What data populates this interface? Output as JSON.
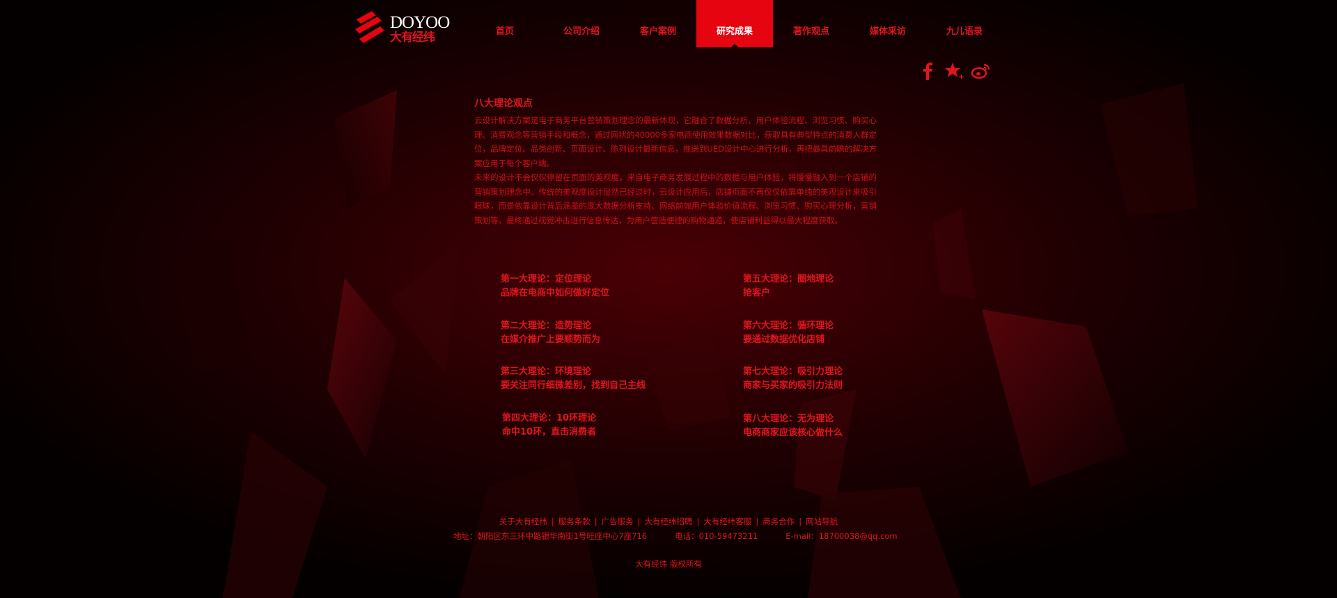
{
  "brand": {
    "name_en": "DOYOO",
    "name_cn": "大有经纬",
    "accent_color": "#e5040f"
  },
  "nav": {
    "items": [
      {
        "label": "首页",
        "active": false
      },
      {
        "label": "公司介绍",
        "active": false
      },
      {
        "label": "客户案例",
        "active": false
      },
      {
        "label": "研究成果",
        "active": true
      },
      {
        "label": "著作观点",
        "active": false
      },
      {
        "label": "媒体采访",
        "active": false
      },
      {
        "label": "九儿语录",
        "active": false
      }
    ]
  },
  "social": {
    "icons": [
      "facebook-icon",
      "star-icon",
      "weibo-icon"
    ]
  },
  "intro": {
    "title": "八大理论观点",
    "paragraph1": "云设计解决方案是电子商务平台营销策划理念的最新体现，它融合了数据分析、用户体验流程、浏览习惯、购买心理、消费观念等营销手段和概念，通过网状的40000多家电商使用效果数据对比，获取具有典型特点的消费人群定位，品牌定位、品类创新、页面设计、陈列设计最新信息，推送到UED设计中心进行分析，再把最具前瞻的解决方案应用于每个客户端。",
    "paragraph2": "未来的设计不会仅仅停留在页面的美观度，来自电子商务发展过程中的数据与用户体验，将慢慢融入到一个店铺的营销策划理念中。传统的美观度设计显然已经过时，云设计应用后，店铺页面不再仅仅依靠单纯的美观设计来吸引眼球，而是依靠设计背后涵盖的庞大数据分析支持、网络前端用户体验价值流程、浏览习惯、购买心理分析，营销策划等，最终通过视觉冲击进行信息传达，为用户营造便捷的购物通道，使店铺利益得以最大程度获取。"
  },
  "theories": [
    {
      "title": "第一大理论：定位理论",
      "desc": "品牌在电商中如何做好定位"
    },
    {
      "title": "第二大理论：造势理论",
      "desc": "在媒介推广上要顺势而为"
    },
    {
      "title": "第三大理论：环境理论",
      "desc": "要关注同行细微差别，找到自己主线"
    },
    {
      "title": "第四大理论：10环理论",
      "desc": "命中10环，直击消费者"
    },
    {
      "title": "第五大理论：圈地理论",
      "desc": "抢客户"
    },
    {
      "title": "第六大理论：循环理论",
      "desc": "要通过数据优化店铺"
    },
    {
      "title": "第七大理论：吸引力理论",
      "desc": "商家与买家的吸引力法则"
    },
    {
      "title": "第八大理论：无为理论",
      "desc": "电商商家应该核心做什么"
    }
  ],
  "footer": {
    "links": [
      "关于大有经纬",
      "服务条款",
      "广告服务",
      "大有经纬招聘",
      "大有经纬客服",
      "商务合作",
      "网站导航"
    ],
    "separator": "|",
    "address": "地址：朝阳区东三环中路银华南街1号旺座中心7座716",
    "phone": "电话：010-59473211",
    "email": "E-mail：18700038@qq.com",
    "copyright": "大有经纬 版权所有"
  }
}
